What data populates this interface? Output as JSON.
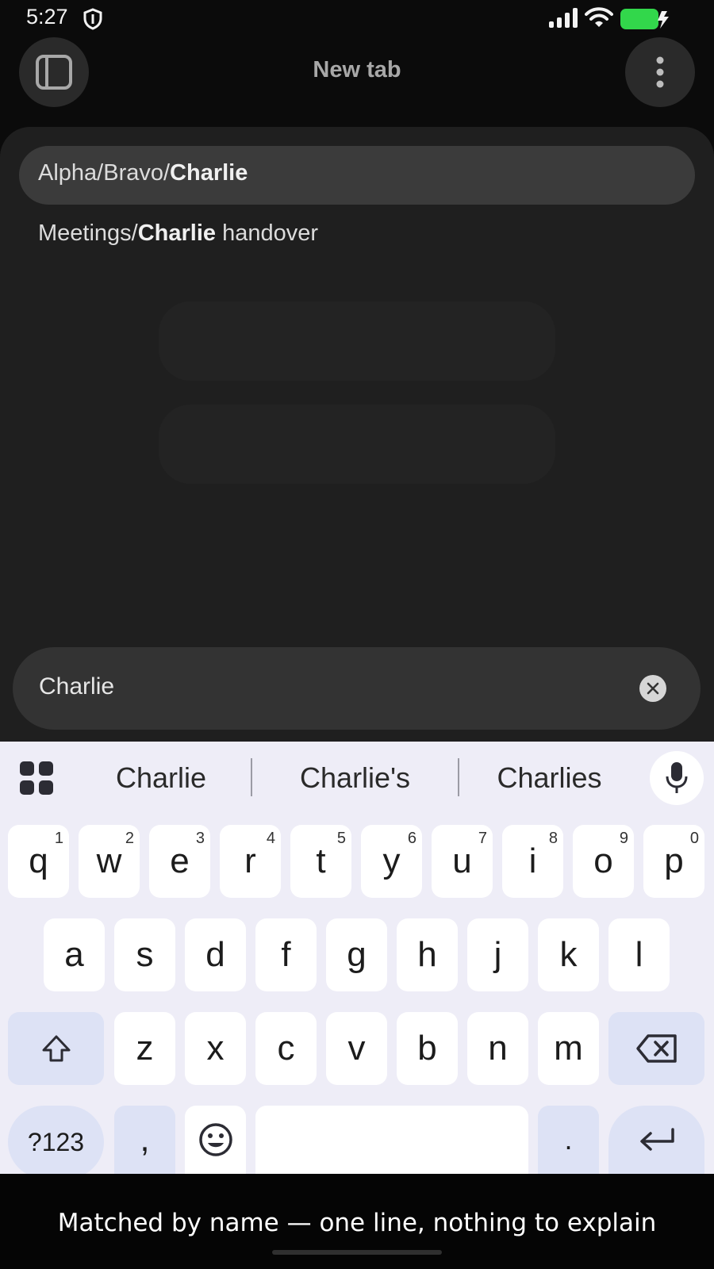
{
  "status_bar": {
    "time": "5:27",
    "battery_color": "#32d74b",
    "icons": [
      "shield-icon",
      "signal-icon",
      "wifi-icon",
      "battery-charging-icon"
    ]
  },
  "top_bar": {
    "title": "New tab",
    "left_icon": "tabs-sidebar-icon",
    "right_icon": "more-vert-icon"
  },
  "suggestions": [
    {
      "prefix": "Alpha/Bravo/",
      "match": "Charlie",
      "suffix": ""
    },
    {
      "prefix": "Meetings/",
      "match": "Charlie",
      "suffix": " handover"
    }
  ],
  "search": {
    "value": "Charlie",
    "clear_icon": "clear-icon"
  },
  "keyboard": {
    "candidates": [
      "Charlie",
      "Charlie's",
      "Charlies"
    ],
    "row1": [
      {
        "k": "q",
        "h": "1"
      },
      {
        "k": "w",
        "h": "2"
      },
      {
        "k": "e",
        "h": "3"
      },
      {
        "k": "r",
        "h": "4"
      },
      {
        "k": "t",
        "h": "5"
      },
      {
        "k": "y",
        "h": "6"
      },
      {
        "k": "u",
        "h": "7"
      },
      {
        "k": "i",
        "h": "8"
      },
      {
        "k": "o",
        "h": "9"
      },
      {
        "k": "p",
        "h": "0"
      }
    ],
    "row2": [
      "a",
      "s",
      "d",
      "f",
      "g",
      "h",
      "j",
      "k",
      "l"
    ],
    "row3": [
      "z",
      "x",
      "c",
      "v",
      "b",
      "n",
      "m"
    ],
    "symbols_label": "?123",
    "comma_label": ",",
    "period_label": ".",
    "accent_color": "#dde2f5"
  },
  "caption": "Matched by name — one line, nothing to explain"
}
